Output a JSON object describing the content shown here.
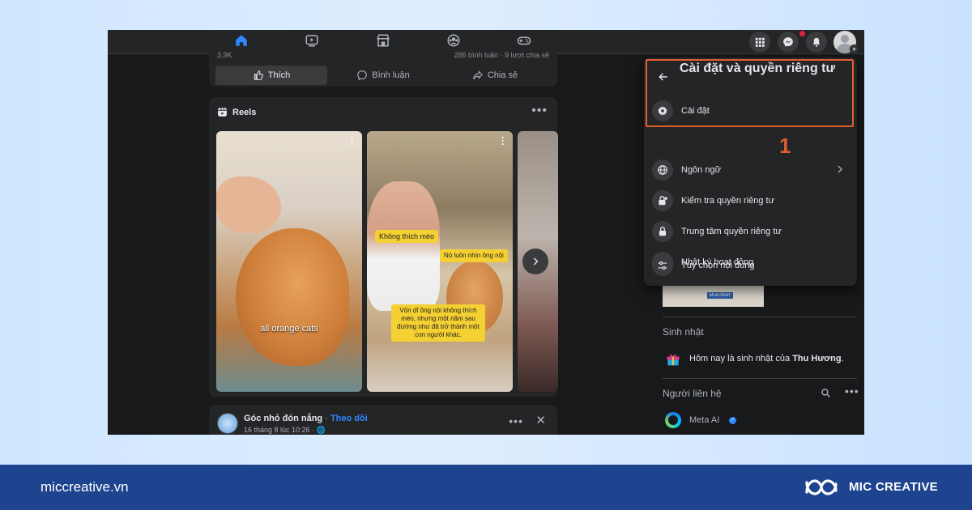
{
  "post": {
    "meta_left": "3,9K",
    "meta_right": "286 bình luận · 9 lượt chia sẻ",
    "like": "Thích",
    "comment": "Bình luận",
    "share": "Chia sẻ"
  },
  "reels": {
    "title": "Reels",
    "caption1": "all orange cats",
    "sticker1": "Không thích mèo",
    "sticker2": "Nó luôn nhìn ông nội",
    "sticker3": "Vốn dĩ ông nội không thích mèo, nhưng một năm sau đường như đã trở thành một con người khác."
  },
  "post2": {
    "name": "Góc nhỏ đón nắng",
    "sep": " · ",
    "follow": "Theo dõi",
    "time": "16 tháng 8 lúc 10:26 · ",
    "globe": "🌐"
  },
  "menu": {
    "title": "Cài đặt và quyền riêng tư",
    "items": [
      {
        "label": "Cài đặt"
      },
      {
        "label": "Ngôn ngữ"
      },
      {
        "label": "Kiểm tra quyền riêng tư"
      },
      {
        "label": "Trung tâm quyền riêng tư"
      },
      {
        "label": "Nhật ký hoạt động"
      },
      {
        "label": "Tùy chọn nội dung"
      }
    ],
    "step": "1"
  },
  "sidebar": {
    "thumb_tag": "MUA NGAY",
    "birthday_title": "Sinh nhật",
    "birthday_prefix": "Hôm nay là sinh nhật của ",
    "birthday_name": "Thu Hương",
    "birthday_suffix": ".",
    "contacts_title": "Người liên hệ",
    "meta_ai": "Meta AI",
    "verified": "✓"
  },
  "footer": {
    "url": "miccreative.vn",
    "brand": "MIC CREATIVE"
  },
  "colors": {
    "highlight": "#e35d30",
    "accent": "#2d88ff",
    "footer": "#1e448f"
  }
}
